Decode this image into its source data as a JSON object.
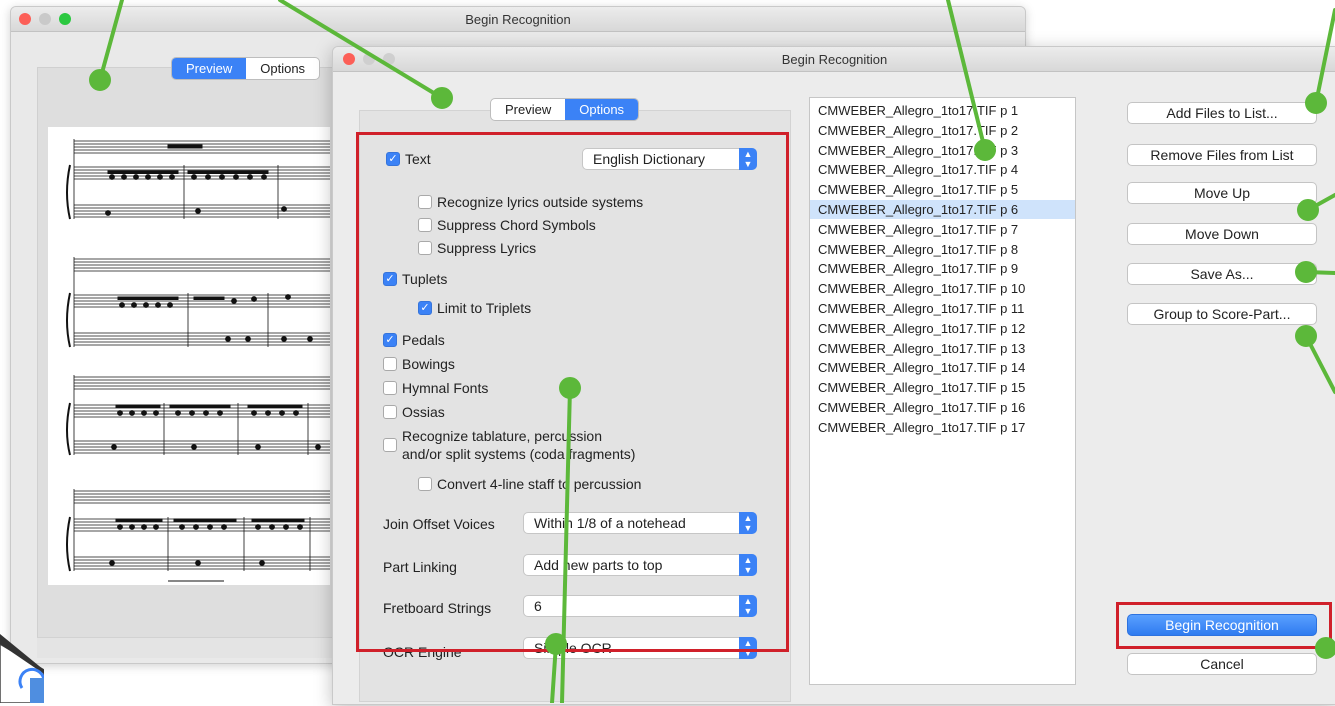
{
  "back_window": {
    "title": "Begin Recognition",
    "seg_preview": "Preview",
    "seg_options": "Options"
  },
  "front_window": {
    "title": "Begin Recognition",
    "seg_preview": "Preview",
    "seg_options": "Options"
  },
  "options": {
    "text_label": "Text",
    "text_dictionary": "English Dictionary",
    "lyrics_outside": "Recognize lyrics outside systems",
    "suppress_chords": "Suppress Chord Symbols",
    "suppress_lyrics": "Suppress Lyrics",
    "tuplets": "Tuplets",
    "limit_triplets": "Limit to Triplets",
    "pedals": "Pedals",
    "bowings": "Bowings",
    "hymnal_fonts": "Hymnal Fonts",
    "ossias": "Ossias",
    "tablature_line1": "Recognize tablature, percussion",
    "tablature_line2": "and/or split systems (coda fragments)",
    "convert_4line": "Convert 4-line staff to percussion",
    "join_offset_label": "Join Offset Voices",
    "join_offset_value": "Within 1/8 of a notehead",
    "part_linking_label": "Part Linking",
    "part_linking_value": "Add new parts to top",
    "fretboard_label": "Fretboard Strings",
    "fretboard_value": "6",
    "ocr_label": "OCR Engine",
    "ocr_value": "Simple OCR"
  },
  "files": [
    "CMWEBER_Allegro_1to17.TIF p  1",
    "CMWEBER_Allegro_1to17.TIF p  2",
    "CMWEBER_Allegro_1to17.TIF p  3",
    "CMWEBER_Allegro_1to17.TIF p  4",
    "CMWEBER_Allegro_1to17.TIF p  5",
    "CMWEBER_Allegro_1to17.TIF p  6",
    "CMWEBER_Allegro_1to17.TIF p  7",
    "CMWEBER_Allegro_1to17.TIF p  8",
    "CMWEBER_Allegro_1to17.TIF p  9",
    "CMWEBER_Allegro_1to17.TIF p 10",
    "CMWEBER_Allegro_1to17.TIF p 11",
    "CMWEBER_Allegro_1to17.TIF p 12",
    "CMWEBER_Allegro_1to17.TIF p 13",
    "CMWEBER_Allegro_1to17.TIF p 14",
    "CMWEBER_Allegro_1to17.TIF p 15",
    "CMWEBER_Allegro_1to17.TIF p 16",
    "CMWEBER_Allegro_1to17.TIF p 17"
  ],
  "selected_file_index": 5,
  "buttons": {
    "add_files": "Add Files to List...",
    "remove_files": "Remove Files from List",
    "move_up": "Move Up",
    "move_down": "Move Down",
    "save_as": "Save As...",
    "group": "Group to Score-Part...",
    "begin": "Begin Recognition",
    "cancel": "Cancel"
  },
  "colors": {
    "accent": "#3b82f6",
    "highlight_box": "#d0202a",
    "callout": "#5cb83a",
    "selection": "#cfe3fb"
  }
}
